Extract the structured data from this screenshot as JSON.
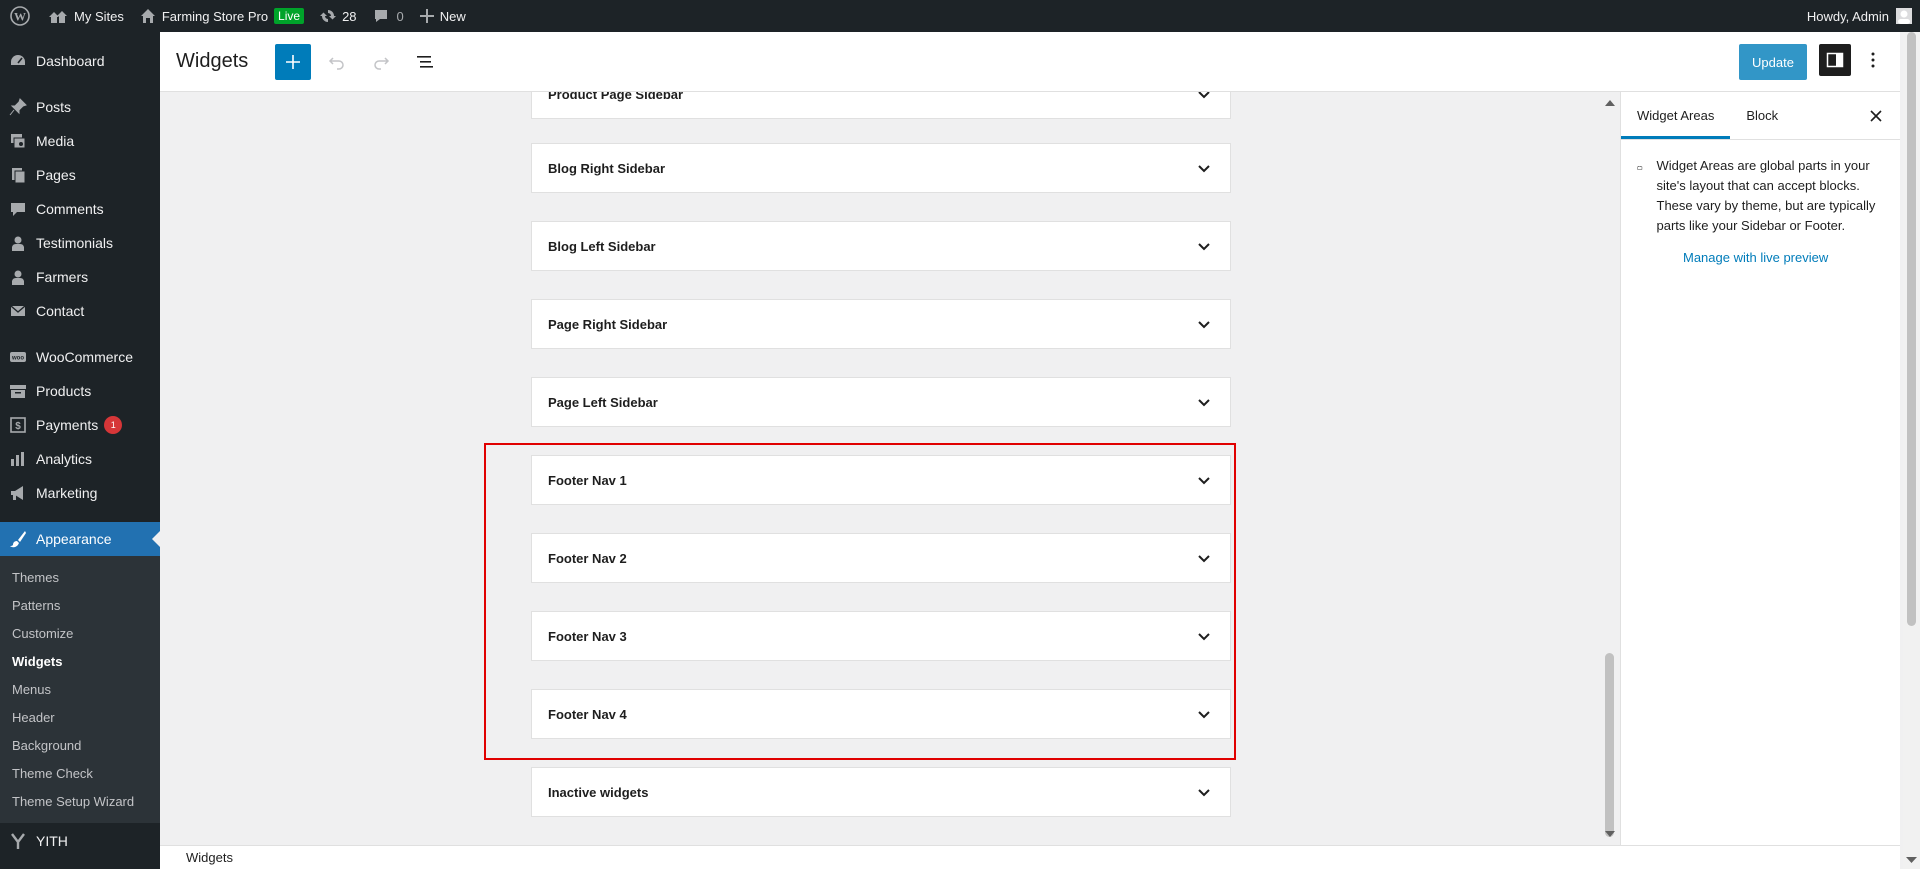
{
  "adminbar": {
    "my_sites": "My Sites",
    "site_name": "Farming Store Pro",
    "live_badge": "Live",
    "updates_count": "28",
    "comments_count": "0",
    "new_label": "New",
    "howdy": "Howdy, Admin"
  },
  "sidebar": {
    "dashboard": "Dashboard",
    "posts": "Posts",
    "media": "Media",
    "pages": "Pages",
    "comments": "Comments",
    "testimonials": "Testimonials",
    "farmers": "Farmers",
    "contact": "Contact",
    "woocommerce": "WooCommerce",
    "products": "Products",
    "payments": "Payments",
    "payments_badge": "1",
    "analytics": "Analytics",
    "marketing": "Marketing",
    "appearance": "Appearance",
    "sub": [
      "Themes",
      "Patterns",
      "Customize",
      "Widgets",
      "Menus",
      "Header",
      "Background",
      "Theme Check",
      "Theme Setup Wizard"
    ],
    "yith": "YITH"
  },
  "header": {
    "title": "Widgets",
    "update_label": "Update"
  },
  "widget_areas": [
    "Product Page Sidebar",
    "Blog Right Sidebar",
    "Blog Left Sidebar",
    "Page Right Sidebar",
    "Page Left Sidebar",
    "Footer Nav 1",
    "Footer Nav 2",
    "Footer Nav 3",
    "Footer Nav 4",
    "Inactive widgets"
  ],
  "inspector": {
    "tab_widget_areas": "Widget Areas",
    "tab_block": "Block",
    "description": "Widget Areas are global parts in your site's layout that can accept blocks. These vary by theme, but are typically parts like your Sidebar or Footer.",
    "live_preview_link": "Manage with live preview"
  },
  "footer": {
    "breadcrumb": "Widgets"
  },
  "colors": {
    "accent": "#007cba",
    "admin_dark": "#1d2327",
    "active_menu": "#2271b1",
    "highlight_border": "#e00000",
    "live_badge": "#00a32a"
  }
}
